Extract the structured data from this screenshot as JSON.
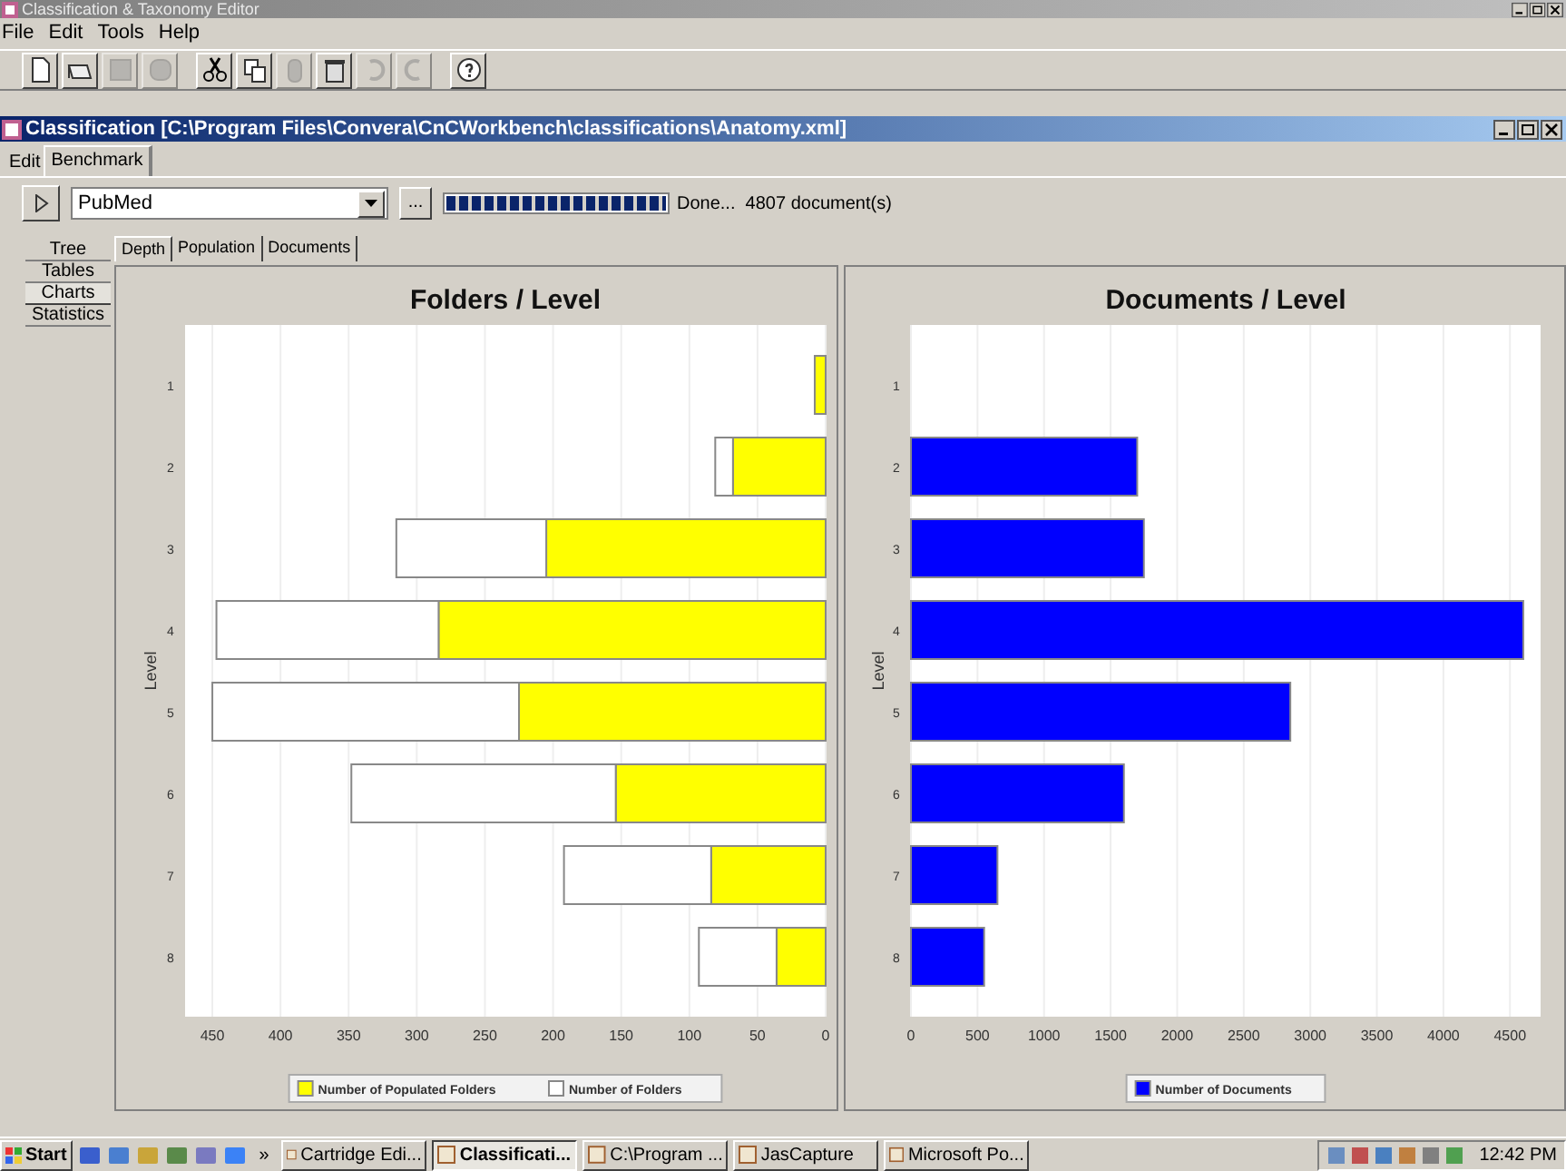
{
  "window": {
    "title": "Classification & Taxonomy Editor"
  },
  "menu": [
    "File",
    "Edit",
    "Tools",
    "Help"
  ],
  "toolbar": [
    {
      "kind": "new",
      "disabled": false
    },
    {
      "kind": "open",
      "disabled": false
    },
    {
      "kind": "save",
      "disabled": true
    },
    {
      "kind": "saveall",
      "disabled": true
    },
    {
      "kind": "cut",
      "disabled": false
    },
    {
      "kind": "copy",
      "disabled": false
    },
    {
      "kind": "paste",
      "disabled": true
    },
    {
      "kind": "delete",
      "disabled": false
    },
    {
      "kind": "undo",
      "disabled": true
    },
    {
      "kind": "redo",
      "disabled": true
    },
    {
      "kind": "help",
      "disabled": false
    }
  ],
  "document_window": {
    "title": "Classification [C:\\Program Files\\Convera\\CnCWorkbench\\classifications\\Anatomy.xml]"
  },
  "tabs": [
    {
      "label": "Edit",
      "selected": false
    },
    {
      "label": "Benchmark",
      "selected": true
    }
  ],
  "benchmark": {
    "source": "PubMed",
    "browse_button": "...",
    "progress": {
      "level": 1
    },
    "status": "Done...  4807 document(s)"
  },
  "side_tabs": [
    {
      "label": "Tree",
      "selected": false
    },
    {
      "label": "Tables",
      "selected": false
    },
    {
      "label": "Charts",
      "selected": true
    },
    {
      "label": "Statistics",
      "selected": false
    }
  ],
  "chart_tabs": [
    {
      "label": "Depth",
      "selected": true
    },
    {
      "label": "Population",
      "selected": false
    },
    {
      "label": "Documents",
      "selected": false
    }
  ],
  "charts": [
    {
      "chart_data": {
        "type": "bar",
        "orientation": "horizontal",
        "stacked": true,
        "grid": true,
        "legend": "bottom",
        "title": "Folders / Level",
        "ylabel": "Level",
        "categories": [
          "1",
          "2",
          "3",
          "4",
          "5",
          "6",
          "7",
          "8"
        ],
        "series": [
          {
            "name": "Number of Populated Folders",
            "color": "#ffff00",
            "values": [
              8,
              68,
              205,
              284,
              225,
              154,
              84,
              36
            ]
          },
          {
            "name": "Number of Folders",
            "color": "#ffffff",
            "values": [
              0,
              13,
              110,
              163,
              225,
              194,
              108,
              57
            ]
          }
        ],
        "xlim": [
          470,
          0
        ],
        "xticks": [
          450,
          400,
          350,
          300,
          250,
          200,
          150,
          100,
          50,
          0
        ]
      }
    },
    {
      "chart_data": {
        "type": "bar",
        "orientation": "horizontal",
        "grid": true,
        "legend": "bottom",
        "title": "Documents / Level",
        "ylabel": "Level",
        "categories": [
          "1",
          "2",
          "3",
          "4",
          "5",
          "6",
          "7",
          "8"
        ],
        "series": [
          {
            "name": "Number of Documents",
            "color": "#0000ff",
            "values": [
              0,
              1700,
              1750,
              4600,
              2850,
              1600,
              650,
              550
            ]
          }
        ],
        "xlim": [
          0,
          4730
        ],
        "xticks": [
          0,
          500,
          1000,
          1500,
          2000,
          2500,
          3000,
          3500,
          4000,
          4500
        ]
      }
    }
  ],
  "taskbar": {
    "start": "Start",
    "more": "»",
    "tasks": [
      {
        "label": "Cartridge Edi...",
        "selected": false
      },
      {
        "label": "Classificati...",
        "selected": true
      },
      {
        "label": "C:\\Program ...",
        "selected": false
      },
      {
        "label": "JasCapture",
        "selected": false
      },
      {
        "label": "Microsoft Po...",
        "selected": false
      }
    ],
    "clock": "12:42 PM"
  }
}
